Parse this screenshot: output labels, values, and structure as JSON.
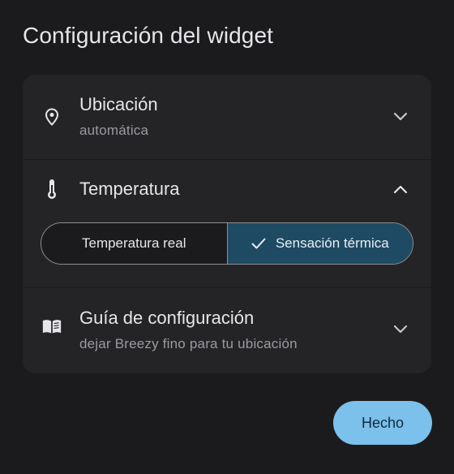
{
  "dialog": {
    "title": "Configuración del widget",
    "done_label": "Hecho"
  },
  "sections": {
    "location": {
      "title": "Ubicación",
      "subtitle": "automática",
      "icon": "location-pin-icon",
      "expanded": false
    },
    "temperature": {
      "title": "Temperatura",
      "icon": "thermometer-icon",
      "expanded": true,
      "options": {
        "real": "Temperatura real",
        "feels_like": "Sensación térmica"
      },
      "selected": "feels_like"
    },
    "guide": {
      "title": "Guía de configuración",
      "subtitle": "dejar Breezy fino para tu ubicación",
      "icon": "book-icon",
      "expanded": false
    }
  },
  "colors": {
    "background": "#1b1b1d",
    "card": "#242427",
    "selected_segment": "#1f4a63",
    "primary_button": "#7cc0ec"
  }
}
